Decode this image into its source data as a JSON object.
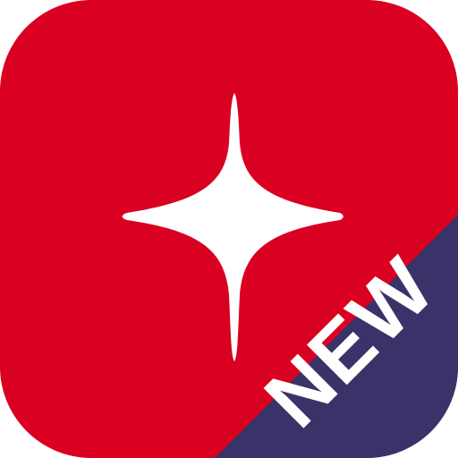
{
  "app_icon": {
    "background_color": "#DA0021",
    "star_color": "#FFFFFF",
    "star_icon": "four-point-sparkle-icon"
  },
  "badge": {
    "label": "NEW",
    "background_color": "#3A3369",
    "text_color": "#FFFFFF"
  }
}
